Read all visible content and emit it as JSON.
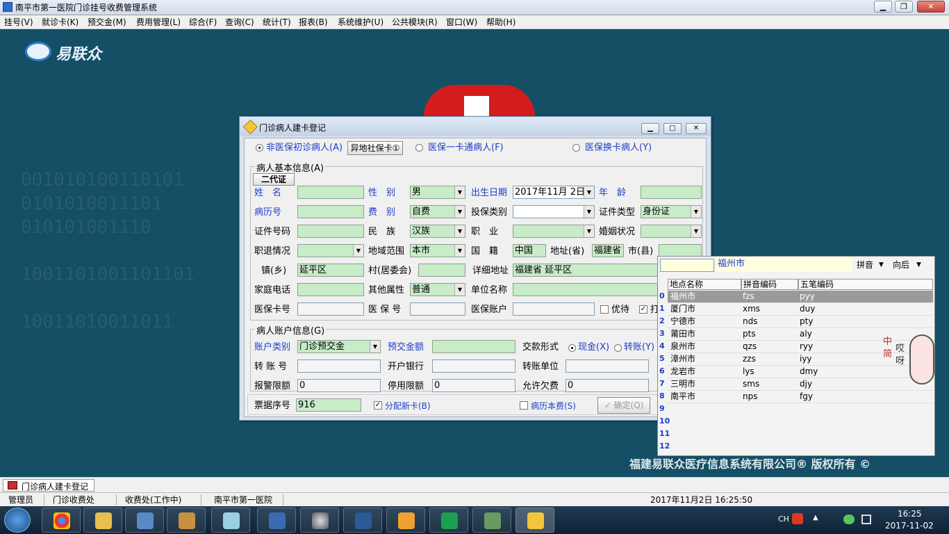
{
  "window": {
    "title": "南平市第一医院门诊挂号收费管理系统"
  },
  "menu": [
    "挂号(V)",
    "就诊卡(K)",
    "预交金(M)",
    "费用管理(L)",
    "综合(F)",
    "查询(C)",
    "统计(T)",
    "报表(B)",
    "系统维护(U)",
    "公共模块(R)",
    "窗口(W)",
    "帮助(H)"
  ],
  "desktop": {
    "logo": "易联众",
    "copyright": "福建易联众医疗信息系统有限公司® 版权所有 ©",
    "bg_code": "001010100110101\n0101010011101\n010101001110\n\n1001101001101101\n\n10011010011011"
  },
  "dialog": {
    "title": "门诊病人建卡登记",
    "top_options": {
      "nonins": "非医保初诊病人(A)",
      "remote_card": "异地社保卡①",
      "onecard": "医保一卡通病人(F)",
      "cardchange": "医保换卡病人(Y)"
    },
    "basic": {
      "group_title": "病人基本信息(A)",
      "id_button": "二代证",
      "name_label": "姓　名",
      "gender_label": "性　别",
      "gender": "男",
      "birth_label": "出生日期",
      "birth": "2017年11月 2日",
      "age_label": "年　龄",
      "record_label": "病历号",
      "fee_label": "费　别",
      "fee": "自费",
      "ins_type_label": "投保类别",
      "cert_type_label": "证件类型",
      "cert_type": "身份证",
      "cert_no_label": "证件号码",
      "ethnic_label": "民　族",
      "ethnic": "汉族",
      "job_label": "职　业",
      "marital_label": "婚姻状况",
      "retire_label": "职退情况",
      "region_label": "地域范围",
      "region": "本市",
      "nation_label": "国　籍",
      "nation": "中国",
      "province_label": "地址(省)",
      "province": "福建省",
      "city_label": "市(县)",
      "town_label": "镇(乡)",
      "town": "延平区",
      "village_label": "村(居委会)",
      "address_label": "详细地址",
      "address": "福建省 延平区",
      "phone_label": "家庭电话",
      "other_label": "其他属性",
      "other": "普通",
      "unit_label": "单位名称",
      "medcard_label": "医保卡号",
      "insno_label": "医 保 号",
      "insacct_label": "医保账户",
      "youdai_label": "优待",
      "print_label": "打"
    },
    "account": {
      "group_title": "病人账户信息(G)",
      "type_label": "账户类别",
      "type": "门诊预交金",
      "amount_label": "预交金额",
      "pay_label": "交款形式",
      "cash": "现金(X)",
      "transfer": "转账(Y)",
      "acct_no_label": "转 账 号",
      "bank_label": "开户银行",
      "unit_label": "转账单位",
      "alarm_label": "报警限额",
      "alarm": "0",
      "stop_label": "停用限额",
      "stop": "0",
      "owe_label": "允许欠费",
      "owe": "0"
    },
    "bottom": {
      "receipt_label": "票据序号",
      "receipt": "916",
      "newcard": "分配新卡(B)",
      "recordfee": "病历本费(S)",
      "ok": "确定(Q)"
    }
  },
  "dropdown": {
    "query": "福州市",
    "mode": "拼音",
    "direction": "向后",
    "headers": [
      "地点名称",
      "拼音编码",
      "五笔编码"
    ],
    "rows": [
      [
        "福州市",
        "fzs",
        "pyy"
      ],
      [
        "厦门市",
        "xms",
        "duy"
      ],
      [
        "宁德市",
        "nds",
        "pty"
      ],
      [
        "莆田市",
        "pts",
        "aly"
      ],
      [
        "泉州市",
        "qzs",
        "ryy"
      ],
      [
        "漳州市",
        "zzs",
        "iyy"
      ],
      [
        "龙岩市",
        "lys",
        "dmy"
      ],
      [
        "三明市",
        "sms",
        "djy"
      ],
      [
        "南平市",
        "nps",
        "fgy"
      ]
    ],
    "rownums": [
      "0",
      "1",
      "2",
      "3",
      "4",
      "5",
      "6",
      "7",
      "8",
      "9",
      "10",
      "11",
      "12"
    ]
  },
  "ime": {
    "chars": [
      "中",
      "哎",
      "简",
      "呀"
    ]
  },
  "mdi_tab": "门诊病人建卡登记",
  "status": {
    "user": "管理员",
    "dept": "门诊收费处",
    "place": "收费处(工作中)",
    "hospital": "南平市第一医院",
    "datetime": "2017年11月2日 16:25:50"
  },
  "taskbar": {
    "ime": "CH",
    "time": "16:25",
    "date": "2017-11-02"
  }
}
